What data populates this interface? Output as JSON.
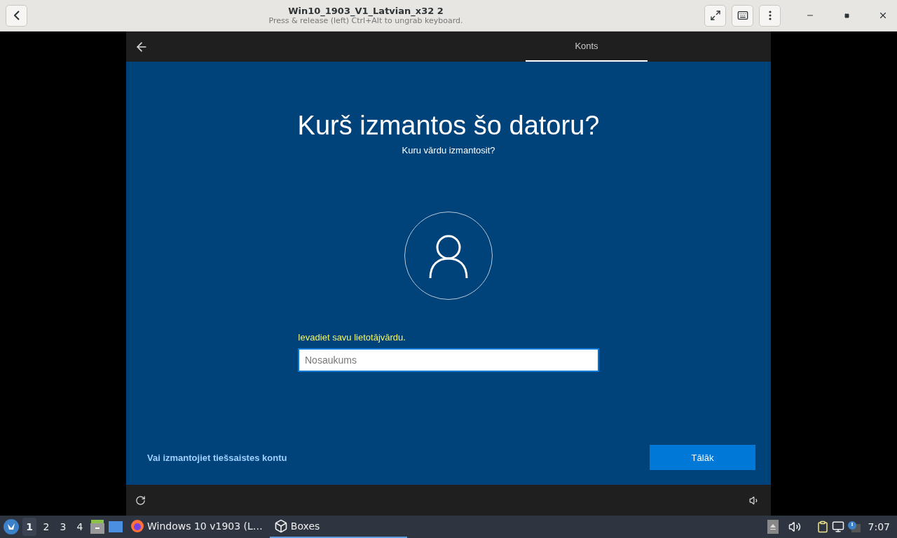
{
  "header": {
    "title": "Win10_1903_V1_Latvian_x32 2",
    "subtitle": "Press & release (left) Ctrl+Alt to ungrab keyboard."
  },
  "vm": {
    "tabs": [
      {
        "label": "Konts",
        "selected": true
      }
    ],
    "heading": "Kurš izmantos šo datoru?",
    "subheading": "Kuru vārdu izmantosit?",
    "prompt": "Ievadiet savu lietotājvārdu.",
    "name_field": {
      "placeholder": "Nosaukums"
    },
    "link": "Vai izmantojiet tiešsaistes kontu",
    "next_button": "Tālāk"
  },
  "taskbar": {
    "workspaces": [
      {
        "label": "1",
        "selected": true
      },
      {
        "label": "2",
        "selected": false
      },
      {
        "label": "3",
        "selected": false
      },
      {
        "label": "4",
        "selected": false
      }
    ],
    "tasks": [
      {
        "kind": "firefox",
        "label": "Windows 10 v1903 (L…",
        "selected": false
      },
      {
        "kind": "boxes",
        "label": "Boxes",
        "selected": true
      }
    ],
    "clock": "7:07"
  }
}
